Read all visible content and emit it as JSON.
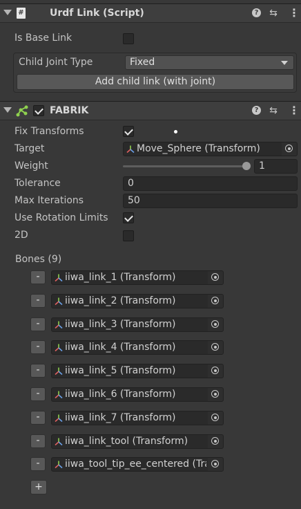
{
  "urdf": {
    "title": "Urdf Link (Script)",
    "is_base_link_label": "Is Base Link",
    "is_base_link": false,
    "child_joint_label": "Child Joint Type",
    "child_joint_value": "Fixed",
    "add_child_label": "Add child link (with joint)"
  },
  "fabrik": {
    "title": "FABRIK",
    "enabled": true,
    "fix_transforms_label": "Fix Transforms",
    "fix_transforms": true,
    "target_label": "Target",
    "target_value": "Move_Sphere (Transform)",
    "weight_label": "Weight",
    "weight_value": "1",
    "weight_fraction": 1.0,
    "tolerance_label": "Tolerance",
    "tolerance_value": "0",
    "max_iter_label": "Max Iterations",
    "max_iter_value": "50",
    "rot_limits_label": "Use Rotation Limits",
    "rot_limits": true,
    "twod_label": "2D",
    "twod": false,
    "bones_label": "Bones (9)",
    "bones": [
      "iiwa_link_1 (Transform)",
      "iiwa_link_2 (Transform)",
      "iiwa_link_3 (Transform)",
      "iiwa_link_4 (Transform)",
      "iiwa_link_5 (Transform)",
      "iiwa_link_6 (Transform)",
      "iiwa_link_7 (Transform)",
      "iiwa_link_tool (Transform)",
      "iiwa_tool_tip_ee_centered (Transform)"
    ],
    "remove_label": "-",
    "add_label": "+"
  },
  "icons": {
    "script": "script-icon",
    "fabrik": "fabrik-icon",
    "help": "help-icon",
    "preset": "preset-icon",
    "menu": "kebab-menu-icon",
    "transform": "transform-icon",
    "object_picker": "object-picker-icon"
  },
  "colors": {
    "background": "#383838",
    "header": "#3e3e3e",
    "field": "#2a2a2a",
    "fabrik_icon": "#8fd14f"
  }
}
